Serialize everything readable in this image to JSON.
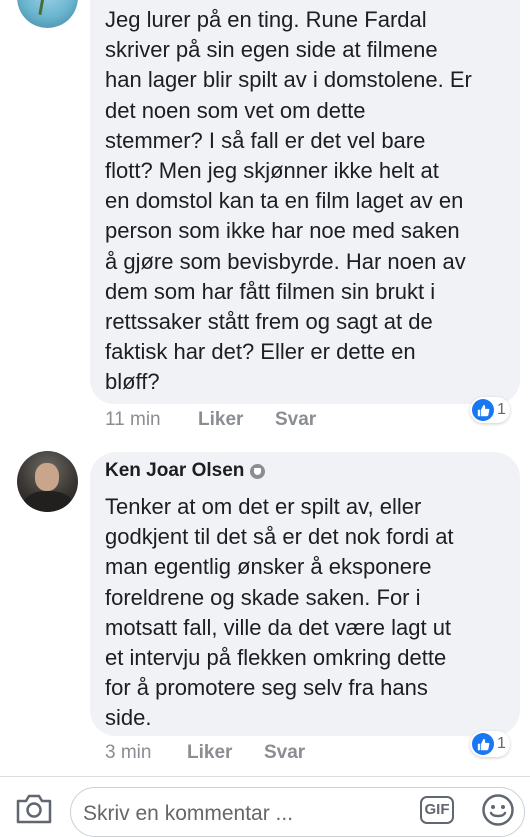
{
  "comments": [
    {
      "author": "",
      "text": "Jeg lurer på en ting. Rune Fardal\nskriver på sin egen side at filmene\nhan lager blir spilt av i domstolene. Er\ndet noen som vet om dette\nstemmer? I så fall er det vel bare\nflott? Men  jeg skjønner ikke helt at\nen domstol kan ta en film laget av en\nperson som ikke har noe med saken\nå gjøre som bevisbyrde. Har noen av\ndem som har fått filmen sin brukt i\nrettssaker stått frem og sagt at de\nfaktisk har det? Eller er dette en\nbløff?",
      "time": "11 min",
      "like_label": "Liker",
      "reply_label": "Svar",
      "reaction_count": "1"
    },
    {
      "author": "Ken Joar Olsen",
      "text": "Tenker at om det er spilt av, eller\ngodkjent til det så er det nok fordi at\nman egentlig ønsker å eksponere\nforeldrene og skade saken. For i\nmotsatt fall, ville da det være lagt ut\net intervju på flekken omkring dette\nfor å promotere seg selv fra hans\nside.",
      "time": "3 min",
      "like_label": "Liker",
      "reply_label": "Svar",
      "reaction_count": "1"
    }
  ],
  "composer": {
    "placeholder": "Skriv en kommentar ...",
    "gif_label": "GIF",
    "camera_icon": "camera-icon",
    "emoji_icon": "emoji-icon"
  },
  "colors": {
    "bubble": "#f0f2f5",
    "meta_text": "#8a8d91",
    "reaction_blue": "#1877f2"
  }
}
